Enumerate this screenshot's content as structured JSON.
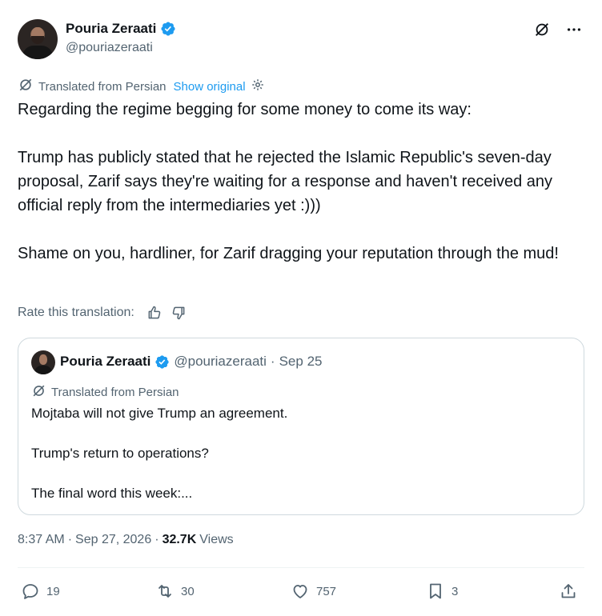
{
  "author": {
    "display_name": "Pouria Zeraati",
    "handle": "@pouriazeraati"
  },
  "translation": {
    "label": "Translated from Persian",
    "show_original": "Show original"
  },
  "tweet": {
    "paragraphs": [
      "Regarding the regime begging for some money to come its way:",
      "Trump has publicly stated that he rejected the Islamic Republic's seven-day proposal, Zarif says they're waiting for a response and haven't received any official reply from the intermediaries yet :)))",
      "Shame on you, hardliner, for Zarif dragging your reputation through the mud!"
    ]
  },
  "rate": {
    "label": "Rate this translation:"
  },
  "quote": {
    "display_name": "Pouria Zeraati",
    "handle": "@pouriazeraati",
    "separator": "·",
    "date": "Sep 25",
    "translation_label": "Translated from Persian",
    "lines": [
      "Mojtaba will not give Trump an agreement.",
      "Trump's return to operations?",
      "The final word this week:..."
    ]
  },
  "meta": {
    "time": "8:37 AM",
    "separator": "·",
    "date": "Sep 27, 2026",
    "views_count": "32.7K",
    "views_label": "Views"
  },
  "actions": {
    "replies": "19",
    "reposts": "30",
    "likes": "757",
    "bookmarks": "3"
  },
  "colors": {
    "accent": "#1d9bf0",
    "text": "#0f1419",
    "muted": "#536471",
    "border": "#cfd9de"
  }
}
